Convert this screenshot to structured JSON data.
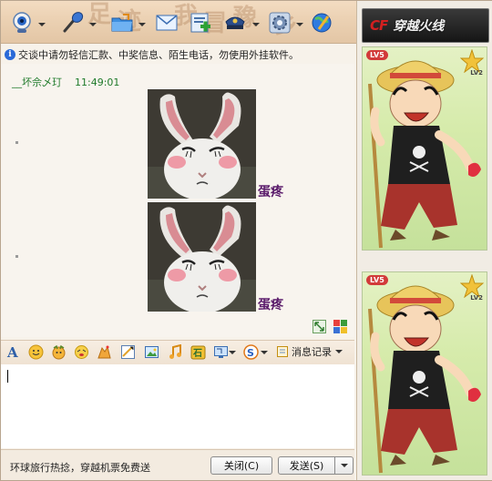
{
  "toolbar": {
    "buttons": [
      {
        "name": "video-call",
        "icon": "webcam-icon"
      },
      {
        "name": "voice-call",
        "icon": "microphone-icon"
      },
      {
        "name": "send-file",
        "icon": "folder-icon"
      },
      {
        "name": "send-mail",
        "icon": "envelope-icon"
      },
      {
        "name": "create-group",
        "icon": "add-contact-icon"
      },
      {
        "name": "app-menu",
        "icon": "police-hat-icon"
      },
      {
        "name": "settings",
        "icon": "gear-icon"
      },
      {
        "name": "more-apps",
        "icon": "globe-icon"
      }
    ]
  },
  "notice": {
    "text": "交谈中请勿轻信汇款、中奖信息、陌生电话，勿使用外挂软件。"
  },
  "chat": {
    "sender": "__坏佘乄玎",
    "time": "11:49:01",
    "messages": [
      {
        "image": "crying-rabbit-emoticon",
        "caption": "蛋疼"
      },
      {
        "image": "crying-rabbit-emoticon",
        "caption": "蛋疼"
      }
    ]
  },
  "format_toolbar": {
    "icons": [
      "font-icon",
      "smiley-icon",
      "magic-face-icon",
      "shake-icon",
      "gift-icon",
      "doodle-icon",
      "image-icon",
      "music-icon",
      "puzzle-icon",
      "screenshot-icon",
      "sogou-icon"
    ],
    "history_label": "消息记录"
  },
  "input": {
    "value": ""
  },
  "bottom": {
    "ad_text": "环球旅行热捻，穿越机票免费送",
    "close_label": "关闭(C)",
    "send_label": "发送(S)"
  },
  "side": {
    "game_title": "穿越火线",
    "game_logo": "CF",
    "shows": [
      {
        "level": "LV5",
        "star_level": "LV2",
        "avatar": "straw-hat-boy-avatar"
      },
      {
        "level": "LV5",
        "star_level": "LV2",
        "avatar": "straw-hat-boy-avatar"
      }
    ]
  },
  "colors": {
    "sender": "#1f7a2a",
    "caption": "#5a1a6a",
    "avatar_bg": "#d6ebab"
  }
}
